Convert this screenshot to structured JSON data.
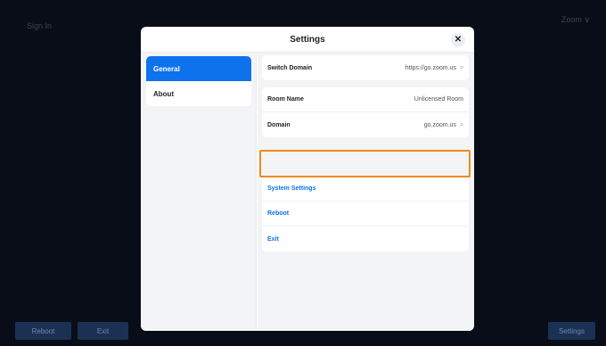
{
  "background": {
    "sign_in": "Sign In",
    "zoom_menu": "Zoom ∨",
    "buttons": {
      "reboot": "Reboot",
      "exit": "Exit",
      "settings": "Settings"
    }
  },
  "modal": {
    "title": "Settings",
    "close_glyph": "✕",
    "sidebar": {
      "items": [
        {
          "label": "General",
          "active": true
        },
        {
          "label": "About",
          "active": false
        }
      ]
    },
    "content": {
      "switch_domain": {
        "label": "Switch Domain",
        "value": "https://go.zoom.us"
      },
      "room_name": {
        "label": "Room Name",
        "value": "Unlicensed Room"
      },
      "domain": {
        "label": "Domain",
        "value": "go.zoom.us"
      },
      "system_settings": "System Settings",
      "reboot": "Reboot",
      "exit": "Exit",
      "chevron": ">"
    }
  },
  "colors": {
    "accent": "#0e72ed",
    "highlight": "#f28a1a",
    "backdrop": "#090d18"
  }
}
